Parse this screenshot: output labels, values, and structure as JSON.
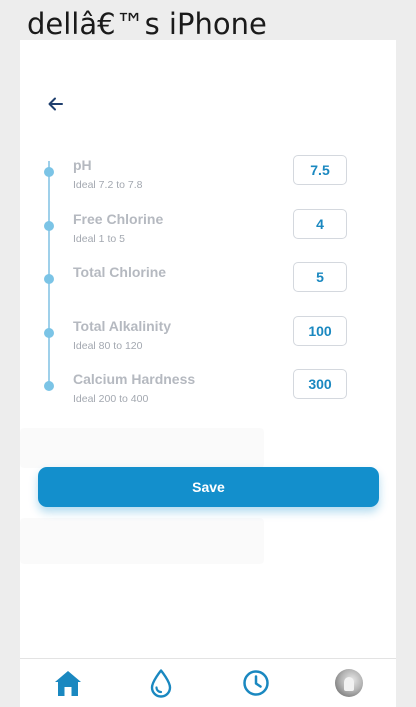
{
  "window": {
    "title": "dellâ€™s iPhone"
  },
  "nav": {
    "back_icon": "arrow-left-icon"
  },
  "readings": [
    {
      "label": "pH",
      "ideal": "Ideal 7.2 to 7.8",
      "value": "7.5"
    },
    {
      "label": "Free Chlorine",
      "ideal": "Ideal 1 to 5",
      "value": "4"
    },
    {
      "label": "Total Chlorine",
      "ideal": "",
      "value": "5"
    },
    {
      "label": "Total Alkalinity",
      "ideal": "Ideal 80 to 120",
      "value": "100"
    },
    {
      "label": "Calcium Hardness",
      "ideal": "Ideal 200 to 400",
      "value": "300"
    }
  ],
  "actions": {
    "save_label": "Save"
  },
  "tabbar": {
    "items": [
      {
        "icon": "home-icon",
        "active": true
      },
      {
        "icon": "water-drop-icon",
        "active": false
      },
      {
        "icon": "clock-icon",
        "active": false
      },
      {
        "icon": "avatar",
        "active": false
      }
    ]
  },
  "colors": {
    "accent": "#138fcc",
    "value_text": "#1a88c0",
    "timeline": "#9fd0ea",
    "label_text": "#b5b9c0"
  }
}
